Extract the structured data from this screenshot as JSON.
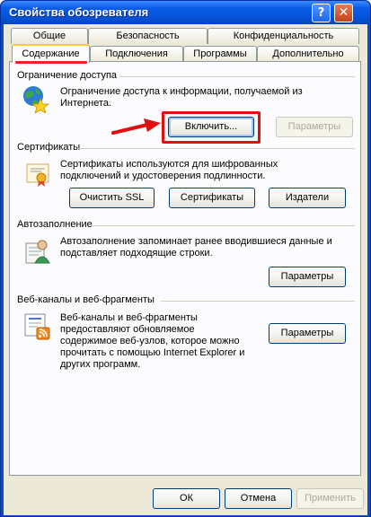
{
  "window": {
    "title": "Свойства обозревателя",
    "help_label": "?",
    "close_label": "✕"
  },
  "tabs": {
    "top_row": [
      "Общие",
      "Безопасность",
      "Конфиденциальность"
    ],
    "bottom_row": [
      "Содержание",
      "Подключения",
      "Программы",
      "Дополнительно"
    ],
    "active": "Содержание"
  },
  "access": {
    "title": "Ограничение доступа",
    "description": "Ограничение доступа к информации, получаемой из Интернета.",
    "enable_label": "Включить...",
    "params_label": "Параметры"
  },
  "certificates": {
    "title": "Сертификаты",
    "description": "Сертификаты используются для шифрованных подключений и удостоверения подлинности.",
    "clear_ssl_label": "Очистить SSL",
    "certificates_label": "Сертификаты",
    "publishers_label": "Издатели"
  },
  "autocomplete": {
    "title": "Автозаполнение",
    "description": "Автозаполнение запоминает ранее вводившиеся данные и подставляет подходящие строки.",
    "params_label": "Параметры"
  },
  "feeds": {
    "title": "Веб-каналы и веб-фрагменты",
    "description": "Веб-каналы и веб-фрагменты предоставляют обновляемое содержимое веб-узлов, которое можно прочитать с помощью Internet Explorer и других программ.",
    "params_label": "Параметры"
  },
  "footer": {
    "ok_label": "ОК",
    "cancel_label": "Отмена",
    "apply_label": "Применить"
  },
  "colors": {
    "title_blue": "#0a5de8",
    "dialog_bg": "#ece9d8",
    "highlight_red": "#e01010"
  }
}
